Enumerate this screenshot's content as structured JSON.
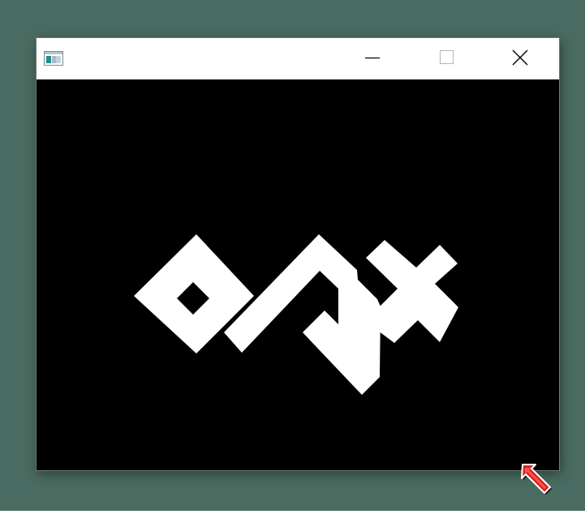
{
  "desktop": {
    "background": "#4a6b61"
  },
  "window": {
    "titlebar_color": "#ffffff",
    "client_color": "#000000",
    "app_icon": "application-window-icon",
    "buttons": {
      "minimize_icon": "minimize-icon",
      "maximize_icon": "maximize-icon",
      "close_icon": "close-icon"
    }
  },
  "content": {
    "logo": "orx-logo",
    "logo_color": "#ffffff"
  },
  "cursor": {
    "icon": "red-arrow-cursor",
    "color": "#e02020"
  }
}
